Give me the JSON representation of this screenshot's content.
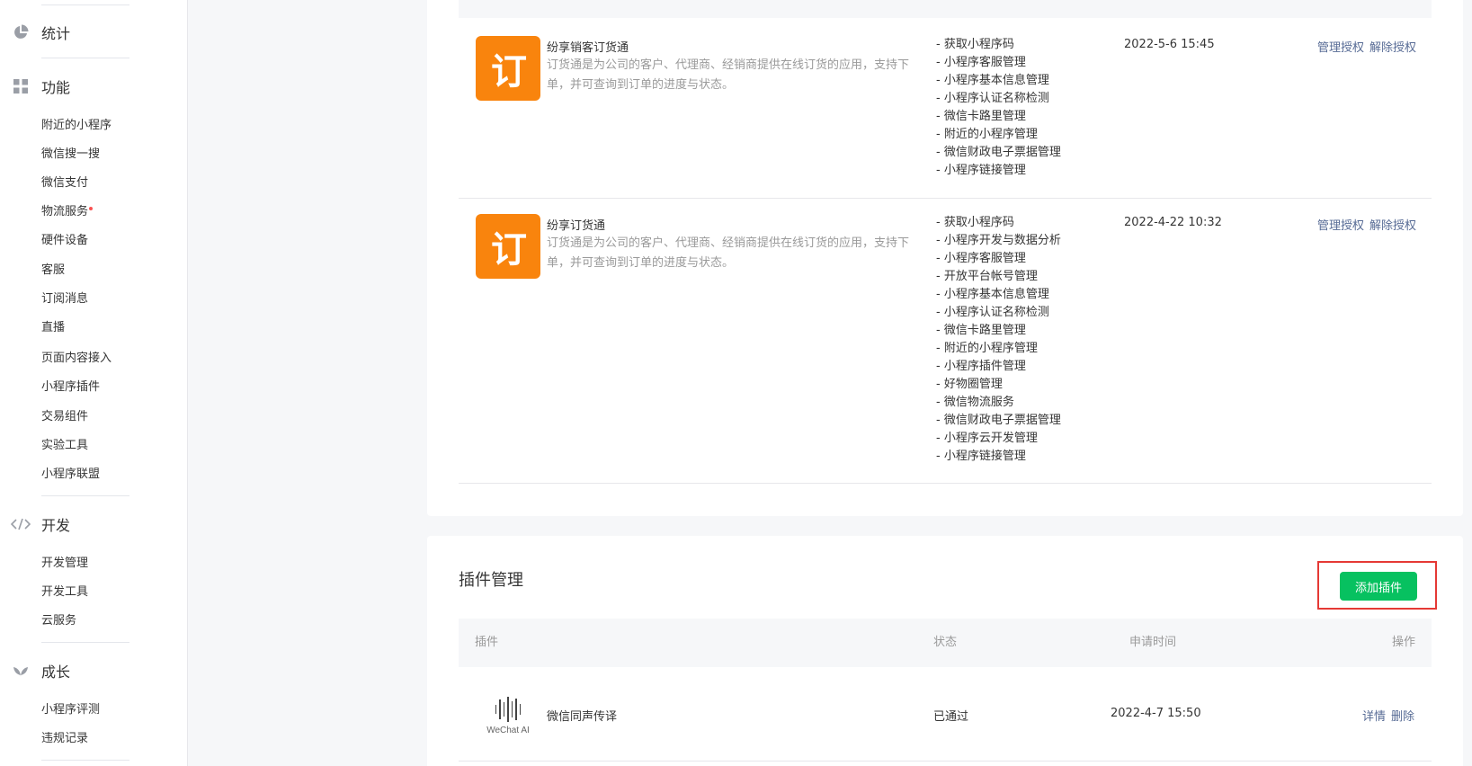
{
  "sidebar": {
    "sections": [
      {
        "icon": "pie-chart-icon",
        "label": "统计"
      },
      {
        "icon": "grid-icon",
        "label": "功能"
      },
      {
        "icon": "code-icon",
        "label": "开发"
      },
      {
        "icon": "sprout-icon",
        "label": "成长"
      }
    ],
    "feature_items": [
      "附近的小程序",
      "微信搜一搜",
      "微信支付",
      "物流服务",
      "硬件设备",
      "客服",
      "订阅消息",
      "直播",
      "页面内容接入",
      "小程序插件",
      "交易组件",
      "实验工具",
      "小程序联盟"
    ],
    "dev_items": [
      "开发管理",
      "开发工具",
      "云服务"
    ],
    "growth_items": [
      "小程序评测",
      "违规记录"
    ]
  },
  "authorizations": [
    {
      "icon_glyph": "订",
      "name": "纷享销客订货通",
      "description": "订货通是为公司的客户、代理商、经销商提供在线订货的应用，支持下单，并可查询到订单的进度与状态。",
      "permissions": [
        "- 获取小程序码",
        "- 小程序客服管理",
        "- 小程序基本信息管理",
        "- 小程序认证名称检测",
        "- 微信卡路里管理",
        "- 附近的小程序管理",
        "- 微信财政电子票据管理",
        "- 小程序链接管理"
      ],
      "time": "2022-5-6 15:45",
      "ops": [
        "管理授权",
        "解除授权"
      ]
    },
    {
      "icon_glyph": "订",
      "name": "纷享订货通",
      "description": "订货通是为公司的客户、代理商、经销商提供在线订货的应用，支持下单，并可查询到订单的进度与状态。",
      "permissions": [
        "- 获取小程序码",
        "- 小程序开发与数据分析",
        "- 小程序客服管理",
        "- 开放平台帐号管理",
        "- 小程序基本信息管理",
        "- 小程序认证名称检测",
        "- 微信卡路里管理",
        "- 附近的小程序管理",
        "- 小程序插件管理",
        "- 好物圈管理",
        "- 微信物流服务",
        "- 微信财政电子票据管理",
        "- 小程序云开发管理",
        "- 小程序链接管理"
      ],
      "time": "2022-4-22 10:32",
      "ops": [
        "管理授权",
        "解除授权"
      ]
    }
  ],
  "plugins": {
    "title": "插件管理",
    "add_button": "添加插件",
    "columns": {
      "plugin": "插件",
      "status": "状态",
      "time": "申请时间",
      "ops": "操作"
    },
    "rows": [
      {
        "logo_caption": "WeChat AI",
        "name": "微信同声传译",
        "status": "已通过",
        "time": "2022-4-7 15:50",
        "ops": [
          "详情",
          "删除"
        ]
      }
    ]
  }
}
